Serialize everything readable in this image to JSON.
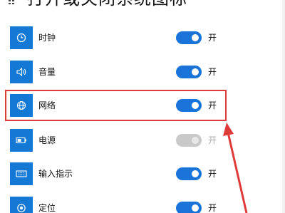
{
  "header": {
    "title": "打开或关闭系统图标",
    "icon": "grid-icon"
  },
  "items": [
    {
      "label": "时钟",
      "icon": "clock-icon",
      "state": "开",
      "enabled": true,
      "on": true
    },
    {
      "label": "音量",
      "icon": "speaker-icon",
      "state": "开",
      "enabled": true,
      "on": true
    },
    {
      "label": "网络",
      "icon": "globe-icon",
      "state": "开",
      "enabled": true,
      "on": true
    },
    {
      "label": "电源",
      "icon": "battery-icon",
      "state": "开",
      "enabled": false,
      "on": true
    },
    {
      "label": "输入指示",
      "icon": "keyboard-icon",
      "state": "开",
      "enabled": true,
      "on": true
    },
    {
      "label": "定位",
      "icon": "location-icon",
      "state": "开",
      "enabled": true,
      "on": true
    }
  ],
  "annotation": {
    "highlighted_item": "网络",
    "color": "#e03b3b"
  },
  "colors": {
    "accent": "#1379d4",
    "toggle_on": "#1a73d9",
    "toggle_disabled": "#c9c9c9"
  }
}
